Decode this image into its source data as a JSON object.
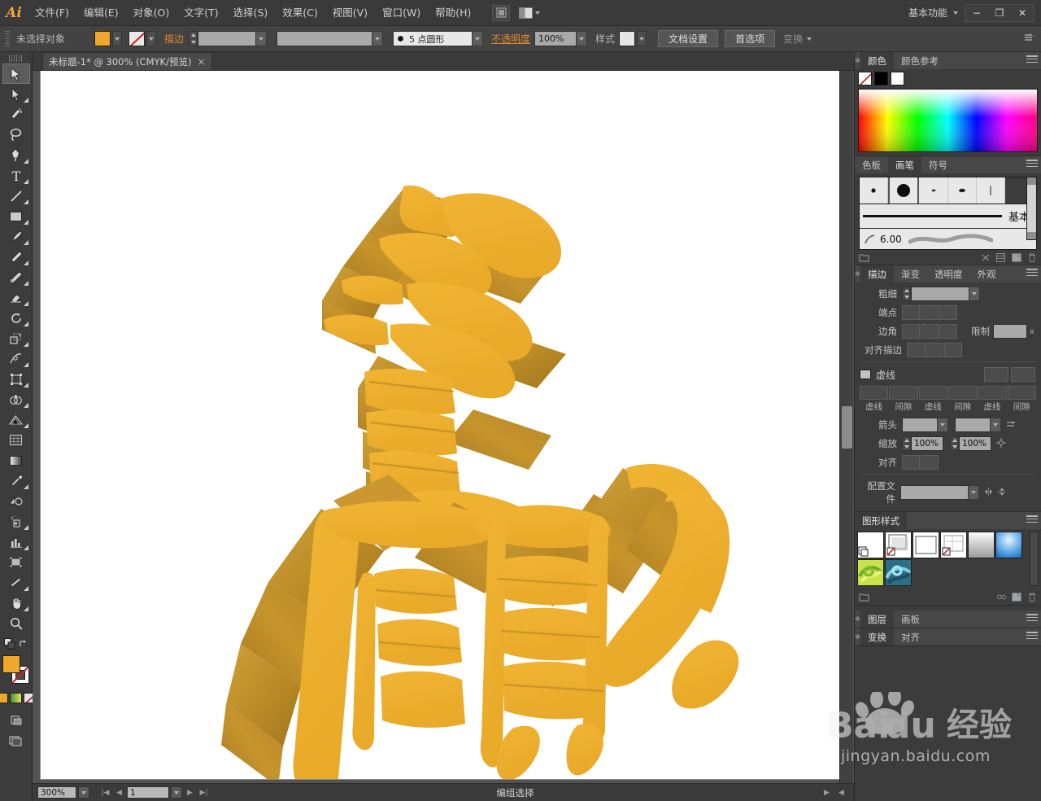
{
  "app": {
    "name": "Adobe Illustrator",
    "logo_text": "Ai",
    "workspace": "基本功能"
  },
  "menubar": {
    "items": [
      {
        "label": "文件(F)"
      },
      {
        "label": "编辑(E)"
      },
      {
        "label": "对象(O)"
      },
      {
        "label": "文字(T)"
      },
      {
        "label": "选择(S)"
      },
      {
        "label": "效果(C)"
      },
      {
        "label": "视图(V)"
      },
      {
        "label": "窗口(W)"
      },
      {
        "label": "帮助(H)"
      }
    ],
    "bridge_icon": "bridge-icon",
    "arrange_icon": "arrange-documents-icon",
    "window_controls": {
      "minimize": "−",
      "restore": "❐",
      "close": "✕"
    }
  },
  "controlbar": {
    "selection_status": "未选择对象",
    "fill_label": "fill-swatch",
    "stroke_label": "stroke-swatch",
    "stroke_text": "描边",
    "stroke_weight_value": "",
    "brush_definition_value": "",
    "style_dropdown_value": "",
    "opacity_label": "不透明度",
    "opacity_value": "100%",
    "graphic_style_label": "样式",
    "document_setup": "文档设置",
    "preferences": "首选项",
    "transform_label": "变换"
  },
  "document": {
    "tab_title": "未标题-1* @ 300% (CMYK/预览)",
    "close_glyph": "×"
  },
  "artwork": {
    "description": "3D 立体金色书法字 — 意顾",
    "face_color": "#EDAF2B",
    "side_color": "#C2902A",
    "dark_side_color": "#A87A23",
    "top_color": "#D9A02C",
    "background": "#FFFFFF"
  },
  "toolbar": {
    "tools": [
      {
        "name": "selection-tool",
        "label": "选择工具",
        "active": true,
        "flyout": false
      },
      {
        "name": "direct-selection-tool",
        "label": "直接选择工具",
        "active": false,
        "flyout": true
      },
      {
        "name": "magic-wand-tool",
        "label": "魔棒工具",
        "active": false,
        "flyout": false
      },
      {
        "name": "lasso-tool",
        "label": "套索工具",
        "active": false,
        "flyout": false
      },
      {
        "name": "pen-tool",
        "label": "钢笔工具",
        "active": false,
        "flyout": true
      },
      {
        "name": "type-tool",
        "label": "文字工具",
        "active": false,
        "flyout": true
      },
      {
        "name": "line-segment-tool",
        "label": "直线段工具",
        "active": false,
        "flyout": true
      },
      {
        "name": "rectangle-tool",
        "label": "矩形工具",
        "active": false,
        "flyout": true
      },
      {
        "name": "paintbrush-tool",
        "label": "画笔工具",
        "active": false,
        "flyout": true
      },
      {
        "name": "pencil-tool",
        "label": "铅笔工具",
        "active": false,
        "flyout": true
      },
      {
        "name": "blob-brush-tool",
        "label": "斑点画笔工具",
        "active": false,
        "flyout": false
      },
      {
        "name": "eraser-tool",
        "label": "橡皮擦工具",
        "active": false,
        "flyout": true
      },
      {
        "name": "rotate-tool",
        "label": "旋转工具",
        "active": false,
        "flyout": true
      },
      {
        "name": "scale-tool",
        "label": "比例缩放工具",
        "active": false,
        "flyout": true
      },
      {
        "name": "width-tool",
        "label": "宽度工具",
        "active": false,
        "flyout": true
      },
      {
        "name": "free-transform-tool",
        "label": "自由变换工具",
        "active": false,
        "flyout": false
      },
      {
        "name": "shape-builder-tool",
        "label": "形状生成器工具",
        "active": false,
        "flyout": true
      },
      {
        "name": "perspective-grid-tool",
        "label": "透视网格工具",
        "active": false,
        "flyout": true
      },
      {
        "name": "mesh-tool",
        "label": "网格工具",
        "active": false,
        "flyout": false
      },
      {
        "name": "gradient-tool",
        "label": "渐变工具",
        "active": false,
        "flyout": false
      },
      {
        "name": "eyedropper-tool",
        "label": "吸管工具",
        "active": false,
        "flyout": true
      },
      {
        "name": "blend-tool",
        "label": "混合工具",
        "active": false,
        "flyout": false
      },
      {
        "name": "symbol-sprayer-tool",
        "label": "符号喷枪工具",
        "active": false,
        "flyout": true
      },
      {
        "name": "column-graph-tool",
        "label": "柱形图工具",
        "active": false,
        "flyout": true
      },
      {
        "name": "artboard-tool",
        "label": "画板工具",
        "active": false,
        "flyout": false
      },
      {
        "name": "slice-tool",
        "label": "切片工具",
        "active": false,
        "flyout": true
      },
      {
        "name": "hand-tool",
        "label": "抓手工具",
        "active": false,
        "flyout": true
      },
      {
        "name": "zoom-tool",
        "label": "缩放工具",
        "active": false,
        "flyout": false
      }
    ],
    "fill_color": "#F0A82C",
    "stroke_color": "#FFFFFF",
    "default_label": "默认填色和描边",
    "swap_label": "互换填色和描边",
    "mode_color": "颜色",
    "mode_gradient": "渐变",
    "mode_none": "无",
    "screen_mode": "更改屏幕模式"
  },
  "panels": {
    "color": {
      "tabs": [
        {
          "label": "颜色",
          "active": true
        },
        {
          "label": "颜色参考",
          "active": false
        }
      ],
      "swatches": [
        "none",
        "#000000",
        "#FFFFFF"
      ]
    },
    "brushes": {
      "tabs": [
        {
          "label": "色板",
          "active": false
        },
        {
          "label": "画笔",
          "active": true
        },
        {
          "label": "符号",
          "active": false
        }
      ],
      "basic_label": "基本",
      "size_value": "6.00",
      "footer_icons": [
        "brush-libraries-icon",
        "remove-brush-stroke-icon",
        "options-icon",
        "new-brush-icon",
        "delete-brush-icon"
      ]
    },
    "stroke": {
      "tabs": [
        {
          "label": "描边",
          "active": true
        },
        {
          "label": "渐变",
          "active": false
        },
        {
          "label": "透明度",
          "active": false
        },
        {
          "label": "外观",
          "active": false
        }
      ],
      "weight_label": "粗细",
      "weight_value": "",
      "cap_label": "端点",
      "corner_label": "边角",
      "limit_label": "限制",
      "limit_value": "",
      "limit_unit": "x",
      "align_label": "对齐描边",
      "dashed_label": "虚线",
      "dash_fields": [
        "虚线",
        "间隙",
        "虚线",
        "间隙",
        "虚线",
        "间隙"
      ],
      "arrow_label": "箭头",
      "scale_label": "缩放",
      "scale_value_1": "100%",
      "scale_value_2": "100%",
      "align_arrow_label": "对齐",
      "profile_label": "配置文件"
    },
    "graphic_styles": {
      "title": "图形样式",
      "styles": [
        {
          "name": "default-style",
          "kind": "plain"
        },
        {
          "name": "shadow-style",
          "kind": "shadow"
        },
        {
          "name": "blank-style",
          "kind": "blank"
        },
        {
          "name": "outline-style",
          "kind": "outline"
        },
        {
          "name": "gray-gradient-style",
          "kind": "graygrad"
        },
        {
          "name": "blue-gradient-style",
          "kind": "bluegrad"
        },
        {
          "name": "green-swirl-style",
          "kind": "greenswirl"
        },
        {
          "name": "teal-swirl-style",
          "kind": "tealswirl"
        }
      ]
    },
    "layers": {
      "tabs": [
        {
          "label": "图层",
          "active": true
        },
        {
          "label": "画板",
          "active": false
        }
      ]
    },
    "transform": {
      "tabs": [
        {
          "label": "变换",
          "active": true
        },
        {
          "label": "对齐",
          "active": false
        }
      ]
    }
  },
  "statusbar": {
    "zoom_value": "300%",
    "page_value": "1",
    "status_text": "编组选择",
    "first_glyph": "|◀",
    "prev_glyph": "◀",
    "next_glyph": "▶",
    "last_glyph": "▶|"
  },
  "watermark": {
    "brand": "Baidu",
    "brand_cn": "经验",
    "url": "jingyan.baidu.com"
  }
}
